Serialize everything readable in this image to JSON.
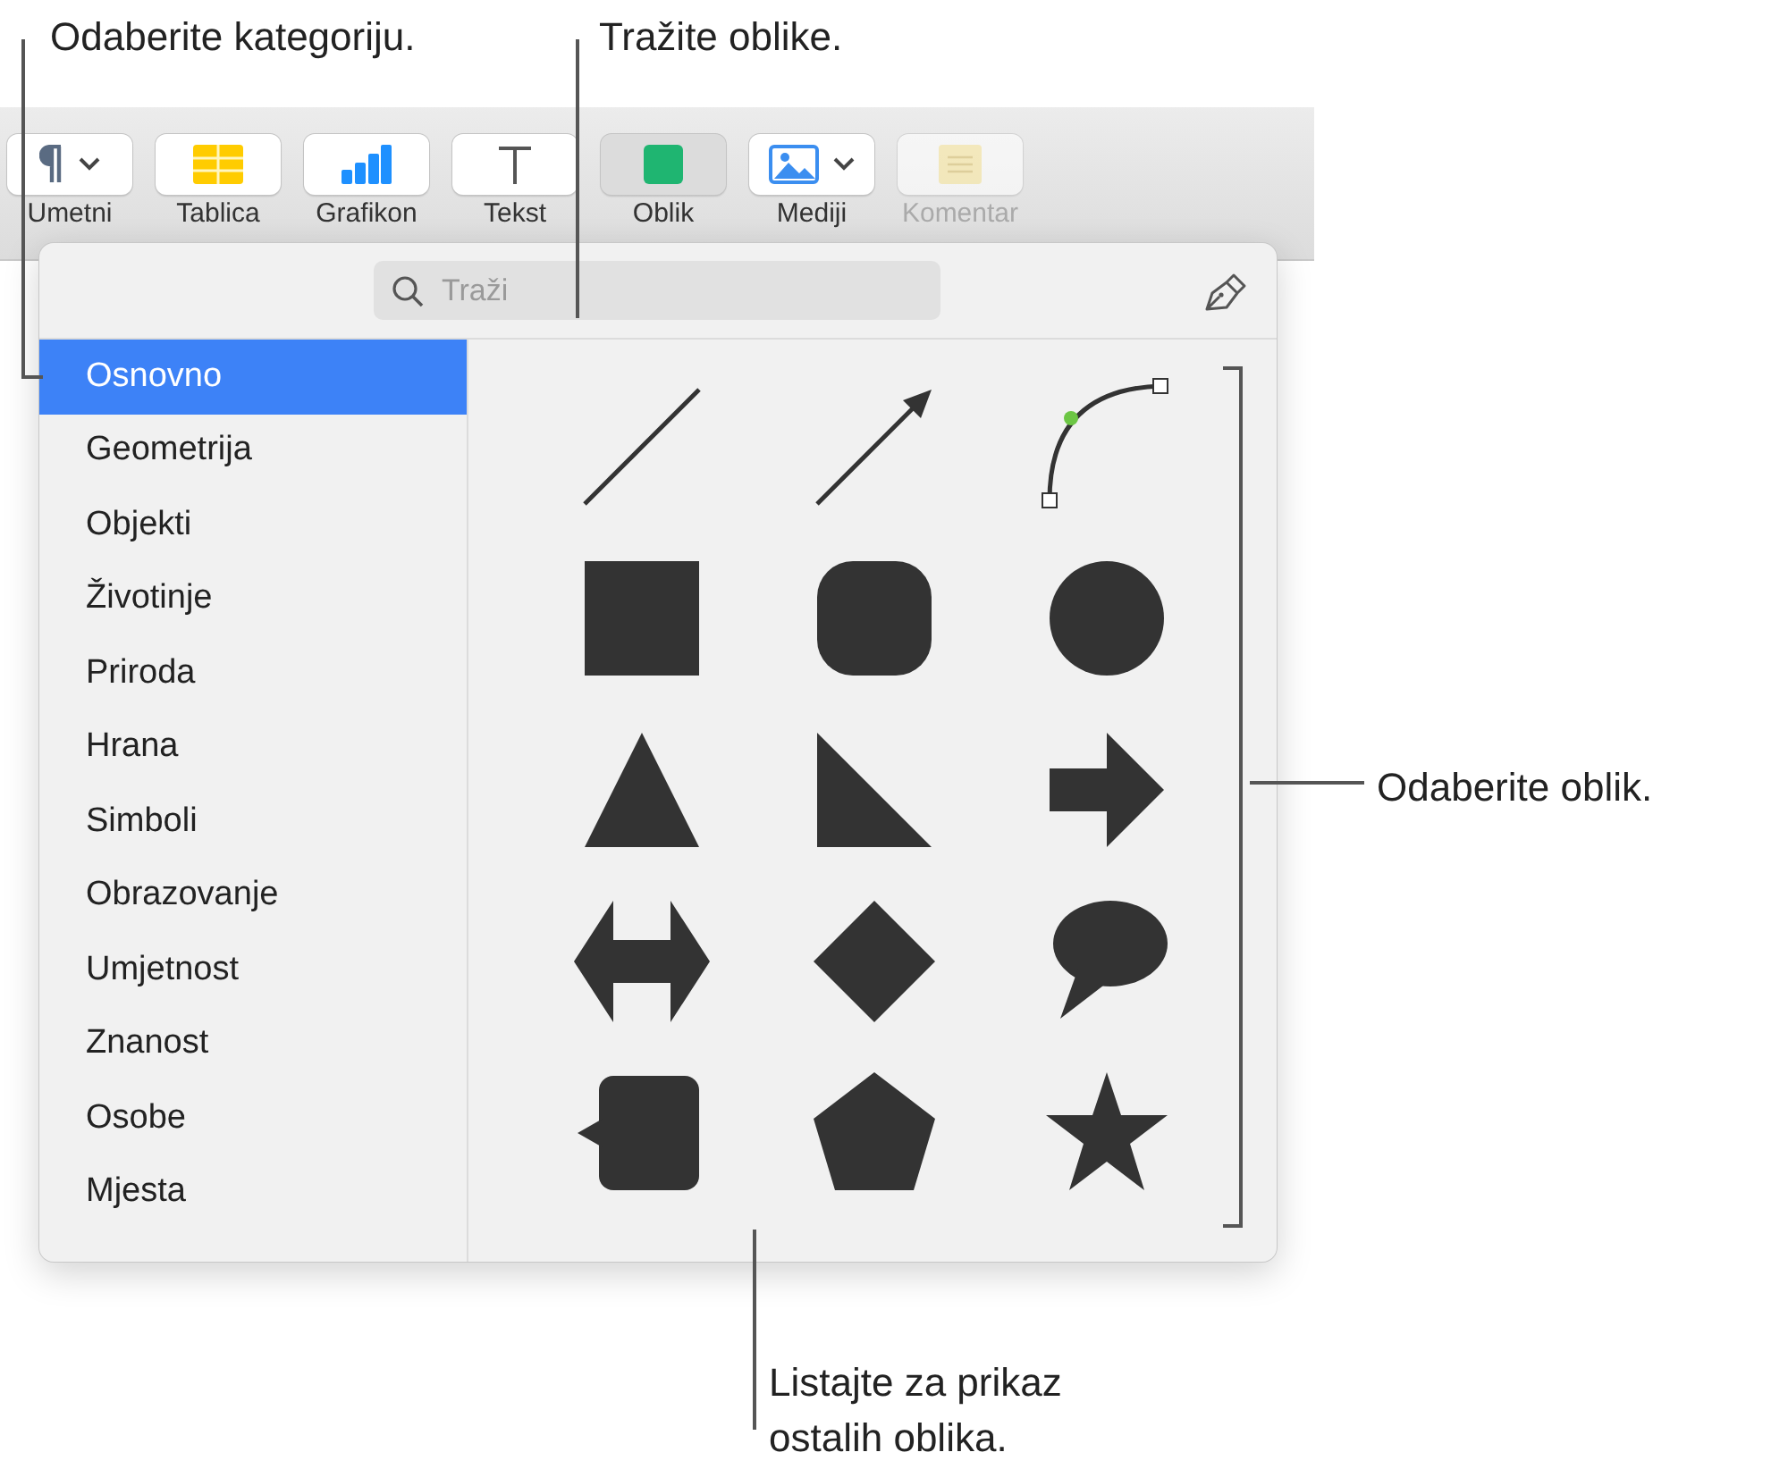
{
  "callouts": [
    {
      "text": "Odaberite kategoriju."
    },
    {
      "text": "Tražite oblike."
    },
    {
      "text": "Odaberite oblik."
    },
    {
      "text": "Listajte za prikaz ostalih oblika."
    }
  ],
  "toolbar": {
    "buttons": [
      {
        "label": "Umetni",
        "kind": "insert",
        "selected": false,
        "disabled": false
      },
      {
        "label": "Tablica",
        "kind": "table",
        "selected": false,
        "disabled": false
      },
      {
        "label": "Grafikon",
        "kind": "chart",
        "selected": false,
        "disabled": false
      },
      {
        "label": "Tekst",
        "kind": "text",
        "selected": false,
        "disabled": false
      },
      {
        "label": "Oblik",
        "kind": "shape",
        "selected": true,
        "disabled": false
      },
      {
        "label": "Mediji",
        "kind": "media",
        "selected": false,
        "disabled": false
      },
      {
        "label": "Komentar",
        "kind": "comment",
        "selected": false,
        "disabled": true
      }
    ]
  },
  "popover": {
    "search": {
      "placeholder": "Traži"
    },
    "categories": [
      {
        "label": "Osnovno",
        "selected": true
      },
      {
        "label": "Geometrija",
        "selected": false
      },
      {
        "label": "Objekti",
        "selected": false
      },
      {
        "label": "Životinje",
        "selected": false
      },
      {
        "label": "Priroda",
        "selected": false
      },
      {
        "label": "Hrana",
        "selected": false
      },
      {
        "label": "Simboli",
        "selected": false
      },
      {
        "label": "Obrazovanje",
        "selected": false
      },
      {
        "label": "Umjetnost",
        "selected": false
      },
      {
        "label": "Znanost",
        "selected": false
      },
      {
        "label": "Osobe",
        "selected": false
      },
      {
        "label": "Mjesta",
        "selected": false
      }
    ],
    "shapes": [
      {
        "kind": "line"
      },
      {
        "kind": "arrow"
      },
      {
        "kind": "curve"
      },
      {
        "kind": "square"
      },
      {
        "kind": "rounded-square"
      },
      {
        "kind": "circle"
      },
      {
        "kind": "triangle"
      },
      {
        "kind": "right-triangle"
      },
      {
        "kind": "right-arrow"
      },
      {
        "kind": "double-arrow"
      },
      {
        "kind": "diamond"
      },
      {
        "kind": "speech-bubble"
      },
      {
        "kind": "callout-square"
      },
      {
        "kind": "pentagon"
      },
      {
        "kind": "star"
      }
    ]
  }
}
